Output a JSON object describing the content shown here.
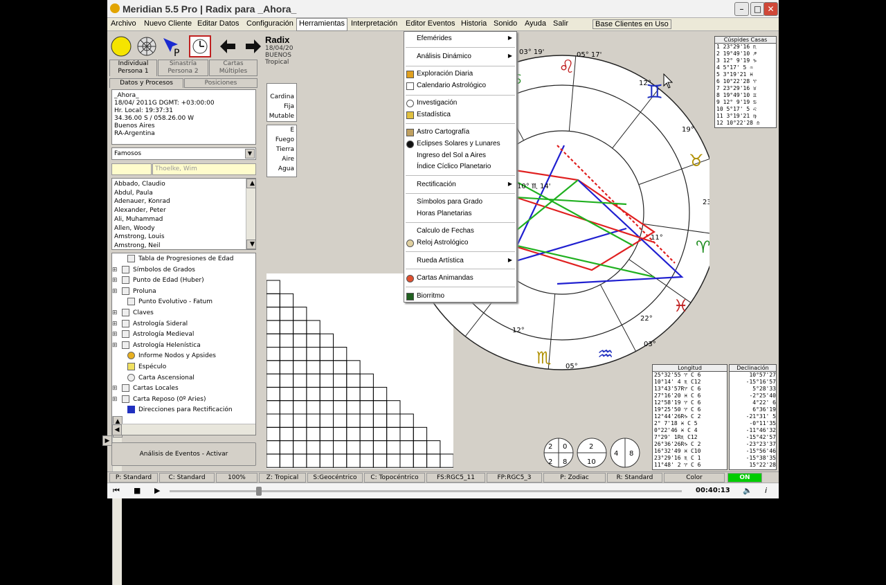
{
  "window": {
    "title": "Meridian 5.5 Pro | Radix para _Ahora_"
  },
  "menubar": [
    "Archivo",
    "Nuevo Cliente",
    "Editar Datos",
    "Configuración",
    "Herramientas",
    "Interpretación",
    "Editor Eventos",
    "Historia",
    "Sonido",
    "Ayuda",
    "Salir",
    "Base Clientes en Uso"
  ],
  "tabs": {
    "individual": "Individual Persona 1",
    "sinastria": "Sinastría Persona 2",
    "cartas": "Cartas Múltiples",
    "datos": "Datos y Procesos",
    "posiciones": "Posiciones"
  },
  "client": {
    "name": "_Ahora_",
    "date": "18/04/ 2011G    DGMT: +03:00:00",
    "local": "Hr. Local: 19:37:31",
    "coords": "34.36.00 S / 058.26.00 W",
    "city": "Buenos Aires",
    "country": "RA-Argentina"
  },
  "filter": {
    "category": "Famosos",
    "search_value": "",
    "search_placeholder": "Thoelke, Wim"
  },
  "famous": [
    "Abbado, Claudio",
    "Abdul, Paula",
    "Adenauer, Konrad",
    "Alexander, Peter",
    "Ali, Muhammad",
    "Allen, Woody",
    "Amstrong, Louis",
    "Amstrong, Neil"
  ],
  "tree": [
    "Tabla de Progresiones de Edad",
    "Símbolos de Grados",
    "Punto de Edad (Huber)",
    "Proluna",
    "Punto Evolutivo - Fatum",
    "Claves",
    "Astrología Sideral",
    "Astrología Medieval",
    "Astrología Helenística",
    "Informe Nodos y Apsides",
    "Espéculo",
    "Carta Ascensional",
    "Cartas Locales",
    "Carta Reposo (0º Aries)",
    "Direcciones para Rectificación"
  ],
  "events_button": "Análisis de Eventos - Activar",
  "chart_header": {
    "title": "Radix",
    "date": "18/04/20",
    "place": "BUENOS",
    "zodiac": "Tropical"
  },
  "qualities": [
    "Cardina",
    "Fija",
    "Mutable"
  ],
  "elements_header": "E",
  "elements": [
    "Fuego",
    "Tierra",
    "Aire",
    "Agua"
  ],
  "menu": {
    "items": [
      {
        "label": "Efemérides",
        "sub": true
      },
      {
        "label": "Análisis Dinámico",
        "sub": true
      },
      {
        "label": "Exploración Diaria",
        "sub": false
      },
      {
        "label": "Calendario Astrológico",
        "sub": false
      },
      {
        "label": "Investigación",
        "sub": false
      },
      {
        "label": "Estadística",
        "sub": false
      },
      {
        "label": "Astro Cartografía",
        "sub": false
      },
      {
        "label": "Eclipses Solares y Lunares",
        "sub": false
      },
      {
        "label": "Ingreso del Sol a Aires",
        "sub": false
      },
      {
        "label": "Índice Cíclico Planetario",
        "sub": false
      },
      {
        "label": "Rectificación",
        "sub": true
      },
      {
        "label": "Símbolos para Grado",
        "sub": false
      },
      {
        "label": "Horas Planetarias",
        "sub": false
      },
      {
        "label": "Calculo de Fechas",
        "sub": false
      },
      {
        "label": "Reloj Astrológico",
        "sub": false
      },
      {
        "label": "Rueda Artística",
        "sub": true
      },
      {
        "label": "Cartas Animandas",
        "sub": false
      },
      {
        "label": "Biorritmo",
        "sub": false
      }
    ]
  },
  "cusps": {
    "title": "Cúspides Casas",
    "rows": [
      "1   23°29'16  ♏",
      "2   19°49'10  ♐",
      "3   12° 9'19  ♑",
      "4    5°17' 5  ♒",
      "5    3°19'21  ♓",
      "6   10°22'28  ♈",
      "7   23°29'16  ♉",
      "8   19°49'10  ♊",
      "9   12° 9'19  ♋",
      "10   5°17' 5  ♌",
      "11   3°19'21  ♍",
      "12  10°22'28  ♎"
    ]
  },
  "longitude": {
    "title": "Longitud",
    "rows": [
      "25°32'55 ♈ C 6",
      "10°14' 4 ♏ C12",
      "13°43'57R♈ C 6",
      "27°16'20 ♓ C 6",
      "12°58'19 ♈ C 6",
      "19°25'50 ♈ C 6",
      "12°44'26R♑ C 2",
      "2° 7'18 ♓ C 5",
      "0°22'46 ♓ C 4",
      "7°29' 1R♏ C12",
      "26°36'26R♑ C 2",
      "16°32'49 ♓ C10",
      "23°29'16 ♏ C 1",
      "11°48' 2 ♈ C 6"
    ]
  },
  "declination": {
    "title": "Declinación",
    "rows": [
      "10°57'27",
      "-15°16'57",
      "5°28'33",
      "-2°25'40",
      "4°22' 6",
      "6°36'19",
      "-21°31' 5",
      "-0°11'35",
      "-11°46'32",
      "-15°42'57",
      "-23°23'37",
      "-15°56'46",
      "-15°38'35",
      "15°22'28"
    ]
  },
  "zodiac_labels": {
    "leo": "♌",
    "cancer": "♋",
    "gemini": "♊",
    "taurus": "♉",
    "aries": "♈",
    "pisces": "♓",
    "aquarius": "♒",
    "scorpio": "♏"
  },
  "degree_labels": [
    "03° 19'",
    "05° 17'",
    "12°",
    "19°",
    "23°",
    "11°",
    "22°",
    "12°",
    "03°",
    "05°",
    "10° ♏ 14'"
  ],
  "summary": {
    "a": "2",
    "b": "0",
    "c": "2",
    "d": "8",
    "e": "2",
    "f": "10",
    "g": "4",
    "h": "8"
  },
  "status": [
    "P: Standard",
    "C: Standard",
    "100%",
    "Z: Tropical",
    "S:Geocéntrico",
    "C: Topocéntrico",
    "FS:RGC5_11",
    "FP:RGC5_3",
    "P: Zodiac",
    "R: Standard",
    "Color",
    "ON"
  ],
  "player": {
    "time": "00:40:13"
  },
  "colors": {
    "menu_active": "#ffffff",
    "status_on": "#00cc00",
    "aspect_red": "#e02020",
    "aspect_blue": "#2020d0",
    "aspect_green": "#20b020"
  }
}
